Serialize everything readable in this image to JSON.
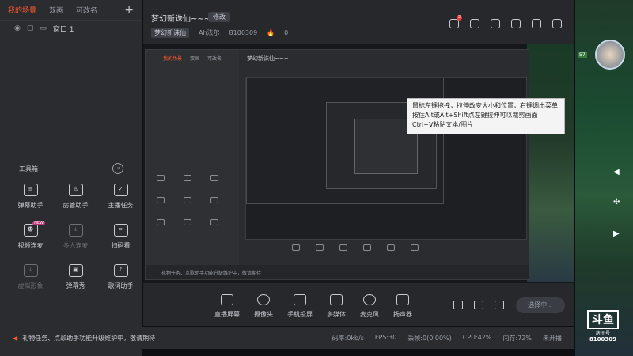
{
  "sidebar": {
    "tabs": [
      "我的场景",
      "双画",
      "可改名"
    ],
    "scene": {
      "label": "窗口 1"
    },
    "toolbox_title": "工具箱",
    "tools": [
      {
        "label": "弹幕助手",
        "dim": false
      },
      {
        "label": "房管助手",
        "dim": false
      },
      {
        "label": "主播任务",
        "dim": false
      },
      {
        "label": "视频连麦",
        "dim": false,
        "badge": "NEW"
      },
      {
        "label": "多人连麦",
        "dim": true
      },
      {
        "label": "扫码看",
        "dim": false
      },
      {
        "label": "虚拟形象",
        "dim": true
      },
      {
        "label": "弹幕秀",
        "dim": false
      },
      {
        "label": "歌词助手",
        "dim": false
      }
    ]
  },
  "header": {
    "title": "梦幻新诛仙~~~",
    "edit_label": "修改",
    "category": "梦幻新诛仙",
    "streamer": "Ah法尔",
    "room_id": "8100309",
    "heat": "0",
    "notification_count": "2"
  },
  "tooltip": {
    "line1": "鼠标左键拖拽，拉伸改变大小和位置，右键调出菜单",
    "line2": "按住Alt或Alt+Shift点左键拉伸可以裁剪画面",
    "line3": "Ctrl+V粘贴文本/图片"
  },
  "controls": [
    {
      "label": "直播屏幕"
    },
    {
      "label": "摄像头"
    },
    {
      "label": "手机投屏"
    },
    {
      "label": "多媒体"
    },
    {
      "label": "麦克风"
    },
    {
      "label": "扬声器"
    }
  ],
  "select_button": "选择中...",
  "statusbar": {
    "notice": "礼物任务、点歌助手功能升级维护中，敬请期待",
    "net": "码率:0kb/s",
    "fps": "FPS:30",
    "drop": "丢帧:0(0.00%)",
    "cpu": "CPU:42%",
    "mem": "内存:72%",
    "state": "未开播"
  },
  "game": {
    "logo": "斗鱼",
    "logo_sub": "房间号",
    "room_id": "8100309",
    "level": "57"
  }
}
